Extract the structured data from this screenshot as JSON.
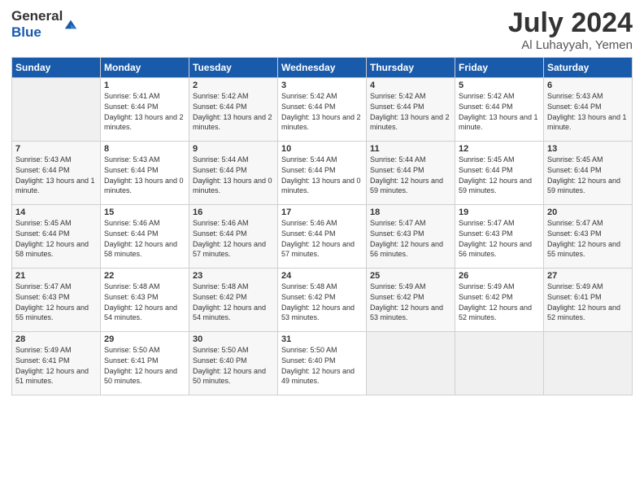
{
  "logo": {
    "general": "General",
    "blue": "Blue"
  },
  "header": {
    "month": "July 2024",
    "location": "Al Luhayyah, Yemen"
  },
  "weekdays": [
    "Sunday",
    "Monday",
    "Tuesday",
    "Wednesday",
    "Thursday",
    "Friday",
    "Saturday"
  ],
  "weeks": [
    [
      {
        "day": "",
        "empty": true
      },
      {
        "day": "1",
        "sunrise": "5:41 AM",
        "sunset": "6:44 PM",
        "daylight": "13 hours and 2 minutes."
      },
      {
        "day": "2",
        "sunrise": "5:42 AM",
        "sunset": "6:44 PM",
        "daylight": "13 hours and 2 minutes."
      },
      {
        "day": "3",
        "sunrise": "5:42 AM",
        "sunset": "6:44 PM",
        "daylight": "13 hours and 2 minutes."
      },
      {
        "day": "4",
        "sunrise": "5:42 AM",
        "sunset": "6:44 PM",
        "daylight": "13 hours and 2 minutes."
      },
      {
        "day": "5",
        "sunrise": "5:42 AM",
        "sunset": "6:44 PM",
        "daylight": "13 hours and 1 minute."
      },
      {
        "day": "6",
        "sunrise": "5:43 AM",
        "sunset": "6:44 PM",
        "daylight": "13 hours and 1 minute."
      }
    ],
    [
      {
        "day": "7",
        "sunrise": "5:43 AM",
        "sunset": "6:44 PM",
        "daylight": "13 hours and 1 minute."
      },
      {
        "day": "8",
        "sunrise": "5:43 AM",
        "sunset": "6:44 PM",
        "daylight": "13 hours and 0 minutes."
      },
      {
        "day": "9",
        "sunrise": "5:44 AM",
        "sunset": "6:44 PM",
        "daylight": "13 hours and 0 minutes."
      },
      {
        "day": "10",
        "sunrise": "5:44 AM",
        "sunset": "6:44 PM",
        "daylight": "13 hours and 0 minutes."
      },
      {
        "day": "11",
        "sunrise": "5:44 AM",
        "sunset": "6:44 PM",
        "daylight": "12 hours and 59 minutes."
      },
      {
        "day": "12",
        "sunrise": "5:45 AM",
        "sunset": "6:44 PM",
        "daylight": "12 hours and 59 minutes."
      },
      {
        "day": "13",
        "sunrise": "5:45 AM",
        "sunset": "6:44 PM",
        "daylight": "12 hours and 59 minutes."
      }
    ],
    [
      {
        "day": "14",
        "sunrise": "5:45 AM",
        "sunset": "6:44 PM",
        "daylight": "12 hours and 58 minutes."
      },
      {
        "day": "15",
        "sunrise": "5:46 AM",
        "sunset": "6:44 PM",
        "daylight": "12 hours and 58 minutes."
      },
      {
        "day": "16",
        "sunrise": "5:46 AM",
        "sunset": "6:44 PM",
        "daylight": "12 hours and 57 minutes."
      },
      {
        "day": "17",
        "sunrise": "5:46 AM",
        "sunset": "6:44 PM",
        "daylight": "12 hours and 57 minutes."
      },
      {
        "day": "18",
        "sunrise": "5:47 AM",
        "sunset": "6:43 PM",
        "daylight": "12 hours and 56 minutes."
      },
      {
        "day": "19",
        "sunrise": "5:47 AM",
        "sunset": "6:43 PM",
        "daylight": "12 hours and 56 minutes."
      },
      {
        "day": "20",
        "sunrise": "5:47 AM",
        "sunset": "6:43 PM",
        "daylight": "12 hours and 55 minutes."
      }
    ],
    [
      {
        "day": "21",
        "sunrise": "5:47 AM",
        "sunset": "6:43 PM",
        "daylight": "12 hours and 55 minutes."
      },
      {
        "day": "22",
        "sunrise": "5:48 AM",
        "sunset": "6:43 PM",
        "daylight": "12 hours and 54 minutes."
      },
      {
        "day": "23",
        "sunrise": "5:48 AM",
        "sunset": "6:42 PM",
        "daylight": "12 hours and 54 minutes."
      },
      {
        "day": "24",
        "sunrise": "5:48 AM",
        "sunset": "6:42 PM",
        "daylight": "12 hours and 53 minutes."
      },
      {
        "day": "25",
        "sunrise": "5:49 AM",
        "sunset": "6:42 PM",
        "daylight": "12 hours and 53 minutes."
      },
      {
        "day": "26",
        "sunrise": "5:49 AM",
        "sunset": "6:42 PM",
        "daylight": "12 hours and 52 minutes."
      },
      {
        "day": "27",
        "sunrise": "5:49 AM",
        "sunset": "6:41 PM",
        "daylight": "12 hours and 52 minutes."
      }
    ],
    [
      {
        "day": "28",
        "sunrise": "5:49 AM",
        "sunset": "6:41 PM",
        "daylight": "12 hours and 51 minutes."
      },
      {
        "day": "29",
        "sunrise": "5:50 AM",
        "sunset": "6:41 PM",
        "daylight": "12 hours and 50 minutes."
      },
      {
        "day": "30",
        "sunrise": "5:50 AM",
        "sunset": "6:40 PM",
        "daylight": "12 hours and 50 minutes."
      },
      {
        "day": "31",
        "sunrise": "5:50 AM",
        "sunset": "6:40 PM",
        "daylight": "12 hours and 49 minutes."
      },
      {
        "day": "",
        "empty": true
      },
      {
        "day": "",
        "empty": true
      },
      {
        "day": "",
        "empty": true
      }
    ]
  ]
}
